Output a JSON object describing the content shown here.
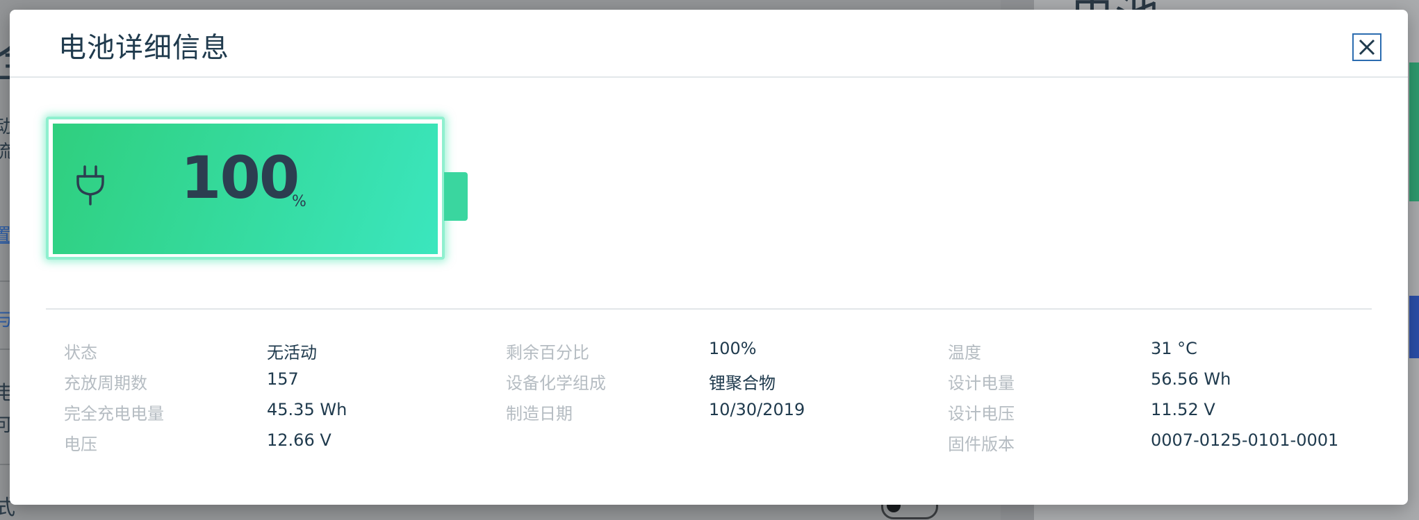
{
  "background": {
    "title_fragment": "电池",
    "left_glyph": "全",
    "left_small_a": "动",
    "left_small_b": "流",
    "left_link": "置",
    "left_link2": "与",
    "left_small_c": "电",
    "left_small_d": "可",
    "left_small_e": "式"
  },
  "dialog": {
    "title": "电池详细信息",
    "close_icon": "close-icon"
  },
  "battery": {
    "level_percent": 100,
    "percent_text": "100",
    "percent_unit": "%",
    "charging_icon": "plug-icon",
    "fill_color_start": "#2fcf7e",
    "fill_color_end": "#3be6be"
  },
  "details": {
    "col1": [
      {
        "label": "状态",
        "value": "无活动"
      },
      {
        "label": "充放周期数",
        "value": "157"
      },
      {
        "label": "完全充电电量",
        "value": "45.35 Wh"
      },
      {
        "label": "电压",
        "value": "12.66 V"
      }
    ],
    "col2": [
      {
        "label": "剩余百分比",
        "value": "100%"
      },
      {
        "label": "设备化学组成",
        "value": "锂聚合物"
      },
      {
        "label": "制造日期",
        "value": "10/30/2019"
      }
    ],
    "col3": [
      {
        "label": "温度",
        "value": "31 °C"
      },
      {
        "label": "设计电量",
        "value": "56.56 Wh"
      },
      {
        "label": "设计电压",
        "value": "11.52 V"
      },
      {
        "label": "固件版本",
        "value": "0007-0125-0101-0001"
      }
    ]
  }
}
